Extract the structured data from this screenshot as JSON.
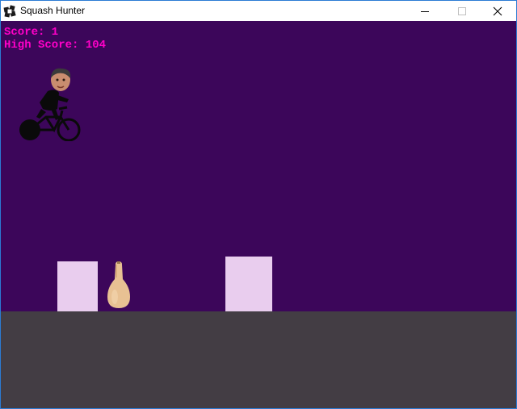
{
  "window": {
    "title": "Squash Hunter",
    "icon": "app-logo-icon",
    "controls": {
      "minimize": "minimize-icon",
      "maximize": "maximize-icon",
      "close": "close-icon"
    }
  },
  "hud": {
    "score": "Score: 1",
    "high_score": "High Score: 104",
    "color": "#ff00c8"
  },
  "scene": {
    "background_color": "#3c065a",
    "ground_color": "#433d44",
    "obstacle_color": "#e9cdee",
    "player": "cyclist-character",
    "collectible": "butternut-squash"
  }
}
